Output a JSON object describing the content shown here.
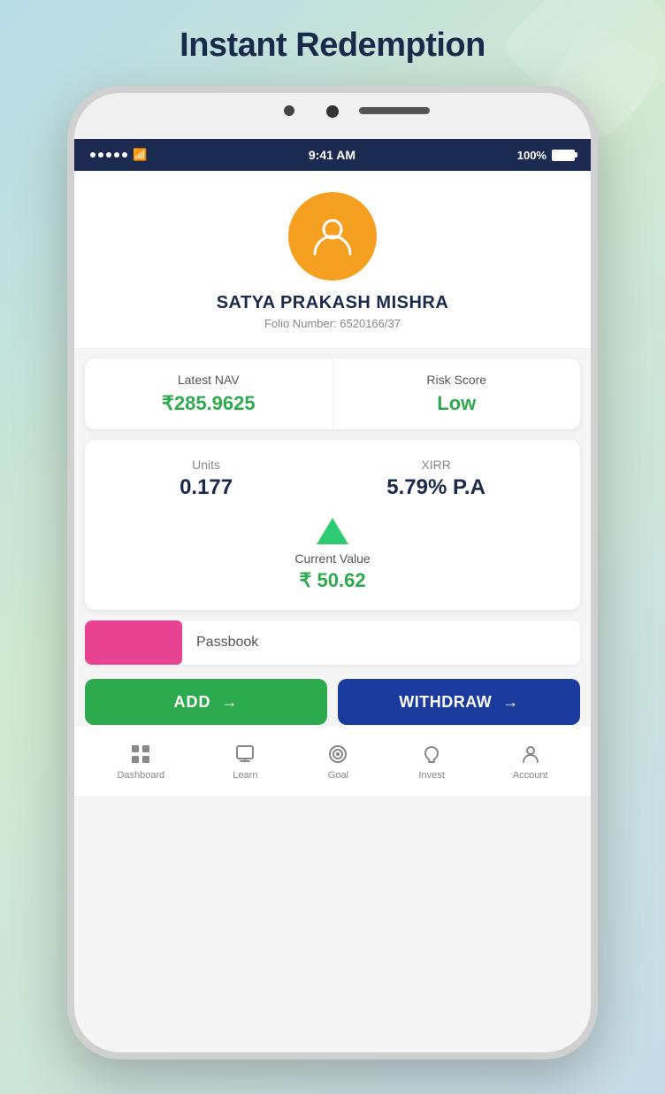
{
  "page": {
    "title": "Instant Redemption",
    "background_colors": [
      "#b8dce8",
      "#d0e8d0"
    ]
  },
  "status_bar": {
    "time": "9:41 AM",
    "battery": "100%"
  },
  "user": {
    "name": "SATYA PRAKASH MISHRA",
    "folio_label": "Folio Number:",
    "folio_number": "6520166/37"
  },
  "nav_card": {
    "latest_nav_label": "Latest NAV",
    "latest_nav_value": "₹285.9625",
    "risk_score_label": "Risk Score",
    "risk_score_value": "Low"
  },
  "units_card": {
    "units_label": "Units",
    "units_value": "0.177",
    "xirr_label": "XIRR",
    "xirr_value": "5.79% P.A",
    "current_label": "Current Value",
    "current_value": "₹ 50.62"
  },
  "passbook": {
    "label": "Passbook"
  },
  "buttons": {
    "add_label": "ADD",
    "withdraw_label": "WITHDRAW"
  },
  "bottom_nav": {
    "items": [
      {
        "id": "dashboard",
        "label": "Dashboard"
      },
      {
        "id": "learn",
        "label": "Learn"
      },
      {
        "id": "goal",
        "label": "Goal"
      },
      {
        "id": "invest",
        "label": "Invest"
      },
      {
        "id": "account",
        "label": "Account"
      }
    ]
  }
}
